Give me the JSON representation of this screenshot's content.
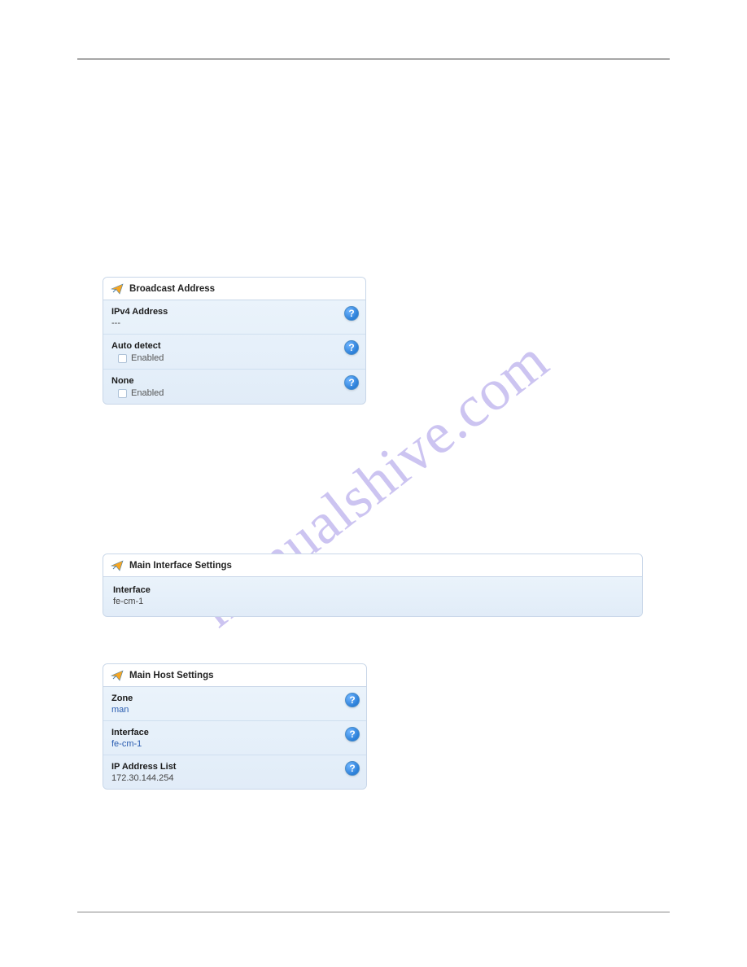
{
  "watermark": "manualshive.com",
  "panels": {
    "broadcast": {
      "title": "Broadcast Address",
      "rows": [
        {
          "label": "IPv4 Address",
          "value": "---"
        },
        {
          "label": "Auto detect",
          "checkbox": "Enabled"
        },
        {
          "label": "None",
          "checkbox": "Enabled"
        }
      ]
    },
    "interface": {
      "title": "Main Interface Settings",
      "rows": [
        {
          "label": "Interface",
          "value": "fe-cm-1"
        }
      ]
    },
    "host": {
      "title": "Main Host Settings",
      "rows": [
        {
          "label": "Zone",
          "link": "man"
        },
        {
          "label": "Interface",
          "link": "fe-cm-1"
        },
        {
          "label": "IP Address List",
          "value": "172.30.144.254"
        }
      ]
    }
  }
}
